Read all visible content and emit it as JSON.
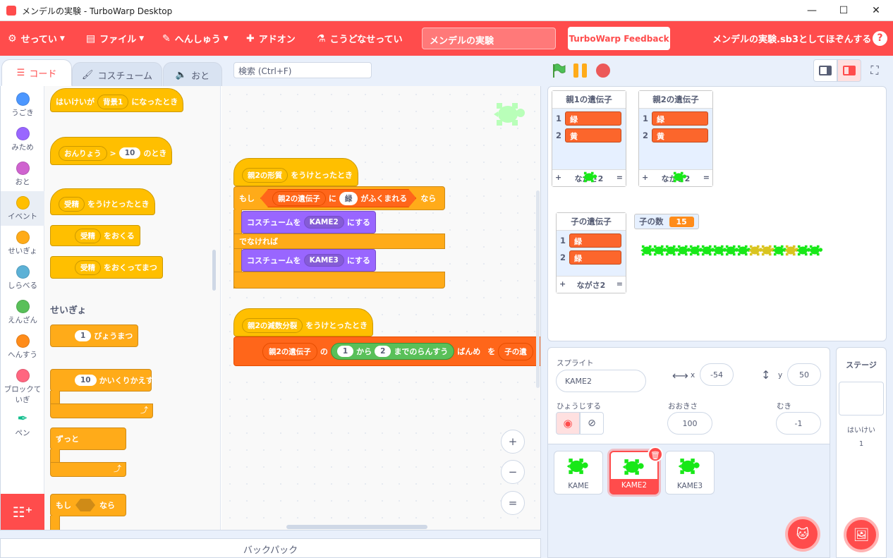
{
  "window": {
    "title": "メンデルの実験 - TurboWarp Desktop",
    "minimize": "—",
    "maximize": "☐",
    "close": "✕"
  },
  "menu": {
    "settings": "せってい",
    "file": "ファイル",
    "edit": "へんしゅう",
    "addons": "アドオン",
    "howto": "こうどなせってい",
    "project_title": "メンデルの実験",
    "feedback": "TurboWarp Feedback",
    "save_hint": "メンデルの実験.sb3としてほぞんする",
    "help": "?"
  },
  "tabs": {
    "code": "コード",
    "costume": "コスチューム",
    "sound": "おと"
  },
  "search": {
    "placeholder": "検索 (Ctrl+F)"
  },
  "categories": [
    {
      "label": "うごき",
      "color": "#4c97ff"
    },
    {
      "label": "みため",
      "color": "#9966ff"
    },
    {
      "label": "おと",
      "color": "#cf63cf"
    },
    {
      "label": "イベント",
      "color": "#ffbf00"
    },
    {
      "label": "せいぎょ",
      "color": "#ffab19"
    },
    {
      "label": "しらべる",
      "color": "#5cb1d6"
    },
    {
      "label": "えんざん",
      "color": "#59c059"
    },
    {
      "label": "へんすう",
      "color": "#ff8c1a"
    },
    {
      "label": "ブロックていぎ",
      "color": "#ff6680"
    },
    {
      "label": "ペン",
      "color": "#0fbd8c"
    }
  ],
  "palette": {
    "b1": {
      "a": "はいけいが",
      "dd": "背景1",
      "b": "になったとき"
    },
    "b2": {
      "dd": "おんりょう",
      "gt": ">",
      "num": "10",
      "b": "のとき"
    },
    "b3": {
      "dd": "受精",
      "b": "をうけとったとき"
    },
    "b4": {
      "dd": "受精",
      "b": "をおくる"
    },
    "b5": {
      "dd": "受精",
      "b": "をおくってまつ"
    },
    "section": "せいぎょ",
    "c1": {
      "num": "1",
      "b": "びょうまつ"
    },
    "c2": {
      "num": "10",
      "b": "かいくりかえす"
    },
    "c3": {
      "a": "ずっと"
    },
    "c4": {
      "a": "もし",
      "b": "なら"
    }
  },
  "script1": {
    "hat_dd": "親2の形質",
    "hat_b": "をうけとったとき",
    "if": "もし",
    "list_dd": "親2の遺伝子",
    "ni": "に",
    "item": "緑",
    "contains": "がふくまれる",
    "then": "なら",
    "cos1_a": "コスチュームを",
    "cos1_dd": "KAME2",
    "cos1_b": "にする",
    "else": "でなければ",
    "cos2_a": "コスチュームを",
    "cos2_dd": "KAME3",
    "cos2_b": "にする"
  },
  "script2": {
    "hat_dd": "親2の減数分裂",
    "hat_b": "をうけとったとき",
    "list_dd": "親2の遺伝子",
    "no": "の",
    "n1": "1",
    "kara": "から",
    "n2": "2",
    "made": "までのらんすう",
    "banme": "ばんめ",
    "wo": "を",
    "ko": "子の遺"
  },
  "zoom": {
    "in": "+",
    "out": "−",
    "reset": "="
  },
  "backpack": "バックパック",
  "monitors": {
    "parent1": {
      "title": "親1の遺伝子",
      "items": [
        "緑",
        "黄"
      ],
      "plus": "+",
      "len": "ながさ2",
      "eq": "="
    },
    "parent2": {
      "title": "親2の遺伝子",
      "items": [
        "緑",
        "黄"
      ],
      "plus": "+",
      "len": "ながさ2",
      "eq": "="
    },
    "child": {
      "title": "子の遺伝子",
      "items": [
        "緑",
        "緑"
      ],
      "plus": "+",
      "len": "ながさ2",
      "eq": "="
    },
    "count": {
      "label": "子の数",
      "value": "15"
    }
  },
  "sprite_info": {
    "sprite_label": "スプライト",
    "name": "KAME2",
    "x_label": "x",
    "x": "-54",
    "y_label": "y",
    "y": "50",
    "show_label": "ひょうじする",
    "size_label": "おおきさ",
    "size": "100",
    "dir_label": "むき",
    "dir": "-1"
  },
  "sprites": [
    {
      "name": "KAME",
      "selected": false
    },
    {
      "name": "KAME2",
      "selected": true
    },
    {
      "name": "KAME3",
      "selected": false
    }
  ],
  "stage_panel": {
    "title": "ステージ",
    "bg_label": "はいけい",
    "bg_count": "1"
  },
  "colors": {
    "accent": "#ff4c4c",
    "events": "#ffbf00",
    "control": "#ffab19",
    "list": "#ff661a",
    "looks": "#9966ff",
    "operator": "#59c059"
  }
}
